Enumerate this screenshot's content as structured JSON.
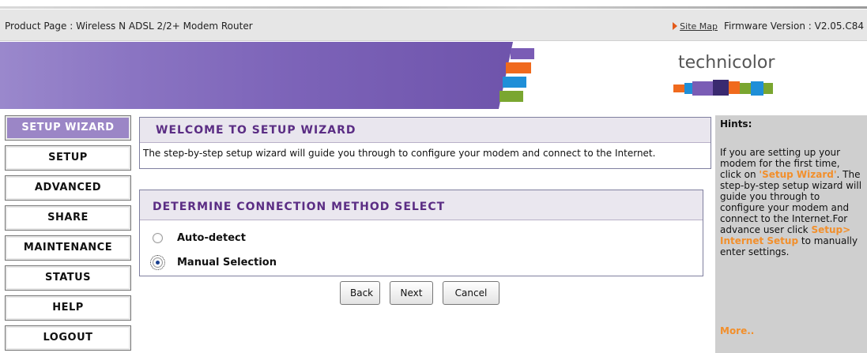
{
  "header": {
    "product": "Product Page : Wireless N ADSL 2/2+ Modem Router",
    "site_map": "Site Map",
    "firmware": "Firmware Version : V2.05.C84"
  },
  "banner": {
    "logo_text": "technicolor",
    "stripe_colors": [
      "#7a5cb5",
      "#f06a1d",
      "#1f8fd8",
      "#7aa630"
    ]
  },
  "nav": {
    "items": [
      {
        "label": "SETUP WIZARD",
        "active": true
      },
      {
        "label": "SETUP"
      },
      {
        "label": "ADVANCED"
      },
      {
        "label": "SHARE"
      },
      {
        "label": "MAINTENANCE"
      },
      {
        "label": "STATUS"
      },
      {
        "label": "HELP"
      },
      {
        "label": "LOGOUT"
      }
    ]
  },
  "welcome": {
    "title": "WELCOME TO SETUP WIZARD",
    "text": "The step-by-step setup wizard will guide you through to configure your modem and connect to the Internet."
  },
  "method": {
    "title": "DETERMINE CONNECTION METHOD SELECT",
    "options": [
      {
        "label": "Auto-detect",
        "checked": false
      },
      {
        "label": "Manual Selection",
        "checked": true
      }
    ]
  },
  "buttons": {
    "back": "Back",
    "next": "Next",
    "cancel": "Cancel"
  },
  "hints": {
    "title": "Hints:",
    "p1": "If you are setting up your modem for the first time, click on ",
    "hl1": "'Setup Wizard'",
    "p2": ". The step-by-step setup wizard will guide you through to configure your modem and connect to the Internet.For advance user click ",
    "hl2": "Setup> Internet Setup",
    "p3": " to manually enter settings.",
    "more": "More.."
  },
  "colors": {
    "accent_purple": "#5b2d84",
    "nav_active": "#9b86c6",
    "hint_highlight": "#f28f2b"
  }
}
